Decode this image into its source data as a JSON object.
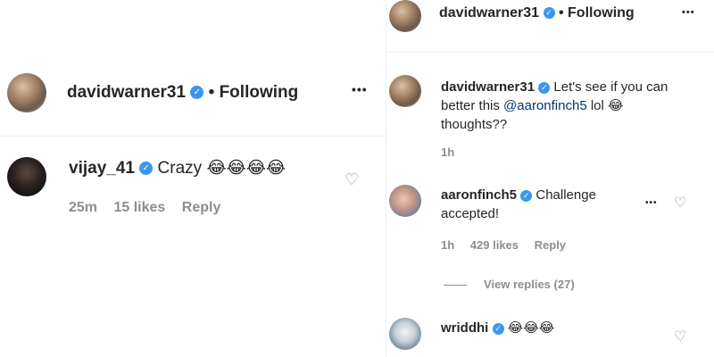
{
  "left": {
    "header": {
      "username": "davidwarner31",
      "separator": "•",
      "follow_status": "Following",
      "more_icon": "•••"
    },
    "comment": {
      "username": "vijay_41",
      "text": "Crazy",
      "emojis": "😂😂😂😂",
      "time": "25m",
      "likes": "15 likes",
      "reply": "Reply"
    }
  },
  "right": {
    "header": {
      "username": "davidwarner31",
      "separator": "•",
      "follow_status": "Following",
      "more_icon": "•••"
    },
    "caption": {
      "username": "davidwarner31",
      "text_before": "Let's see if you can better this ",
      "mention": "@aaronfinch5",
      "text_after": " lol ",
      "emoji": "😂",
      "line3": "thoughts??",
      "time": "1h"
    },
    "comment1": {
      "username": "aaronfinch5",
      "text": "Challenge accepted!",
      "time": "1h",
      "likes": "429 likes",
      "reply": "Reply",
      "more_icon": "•••",
      "view_replies": "View replies (27)"
    },
    "comment2": {
      "username": "wriddhi",
      "emojis": "😂😂😂"
    }
  },
  "colors": {
    "verified": "#3897f0",
    "meta": "#8e8e8e",
    "mention": "#00376b"
  }
}
